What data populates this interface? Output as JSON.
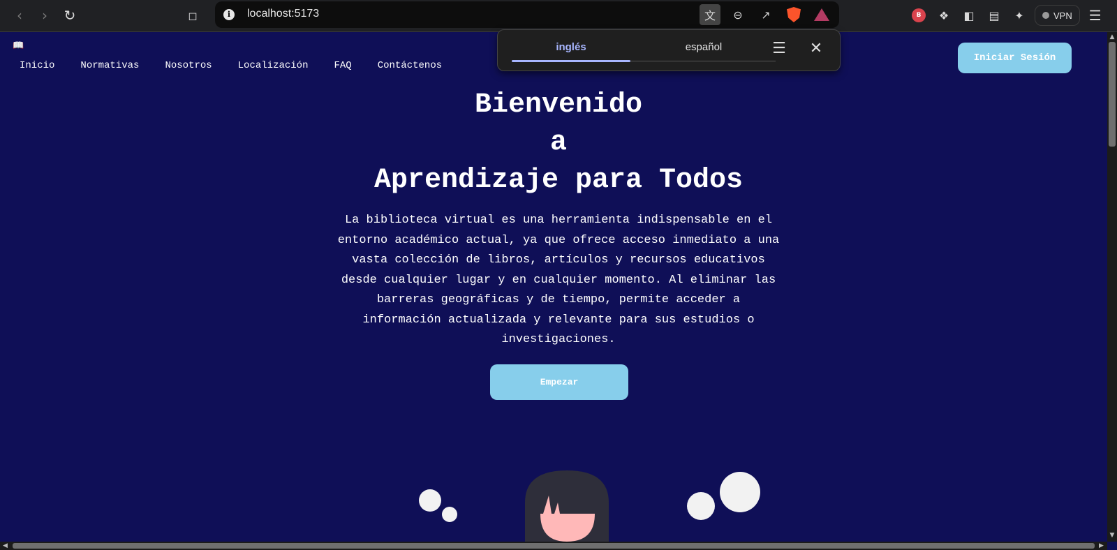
{
  "browser": {
    "url": "localhost:5173",
    "vpn_label": "VPN",
    "brave_rewards_badge": "B"
  },
  "translate_popup": {
    "tabs": [
      "inglés",
      "español"
    ],
    "selected_tab": "inglés"
  },
  "page": {
    "logo_icon": "open-book-icon",
    "nav": [
      "Inicio",
      "Normativas",
      "Nosotros",
      "Localización",
      "FAQ",
      "Contáctenos"
    ],
    "login_button": "Iniciar Sesión",
    "hero": {
      "title_line1": "Bienvenido",
      "title_line2": "a",
      "title_line3": "Aprendizaje para Todos",
      "paragraph": "La biblioteca virtual es una herramienta indispensable en el entorno académico actual, ya que ofrece acceso inmediato a una vasta colección de libros, artículos y recursos educativos desde cualquier lugar y en cualquier momento. Al eliminar las barreras geográficas y de tiempo, permite acceder a información actualizada y relevante para sus estudios o investigaciones.",
      "start_button": "Empezar"
    }
  },
  "colors": {
    "page_background": "#0f0f57",
    "button_accent": "#87ceeb",
    "translate_tab_accent": "#a8b6ff"
  }
}
